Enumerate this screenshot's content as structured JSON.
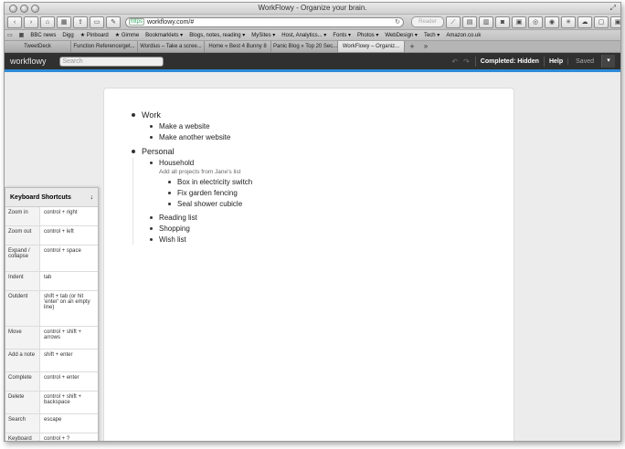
{
  "window": {
    "title": "WorkFlowy - Organize your brain."
  },
  "browser": {
    "toolbar_left": [
      "‹",
      "›",
      "⌂",
      "▦",
      "⇪",
      "▭",
      "✎"
    ],
    "toolbar_right": [
      "⟋",
      "▤",
      "▥",
      "◙",
      "▣",
      "◎",
      "◉",
      "✳",
      "☁",
      "▢",
      "▣",
      "⚙"
    ],
    "url_https": "https",
    "url": "workflowy.com/#",
    "reader": "Reader",
    "bookmarks": [
      "▭",
      "▦",
      "BBC news",
      "Digg",
      "★ Pinboard",
      "★ Gimme",
      "Bookmarklets ▾",
      "Blogs, notes, reading ▾",
      "MySites ▾",
      "Host, Analytics... ▾",
      "Fonts ▾",
      "Photos ▾",
      "WebDesign ▾",
      "Tech ▾",
      "Amazon.co.uk"
    ],
    "tabs": [
      {
        "label": "TweetDeck"
      },
      {
        "label": "Function Reference/get..."
      },
      {
        "label": "Wordius – Take a scree..."
      },
      {
        "label": "Home « Best 4 Bunny 8"
      },
      {
        "label": "Panic Blog » Top 20 Sec..."
      },
      {
        "label": "WorkFlowy – Organiz..."
      }
    ],
    "tab_plus": "+",
    "tab_overflow": "»"
  },
  "app": {
    "logo": "workflowy",
    "search_placeholder": "Search",
    "undo": "↶",
    "redo": "↷",
    "completed_btn": "Completed: Hidden",
    "help_btn": "Help",
    "saved": "Saved",
    "menu": "▾"
  },
  "outline": {
    "work": {
      "text": "Work",
      "children": [
        "Make a website",
        "Make another website"
      ]
    },
    "personal": {
      "text": "Personal",
      "household": {
        "text": "Household",
        "note": "Add all projects from Jane's list",
        "children": [
          "Box in electricity switch",
          "Fix garden fencing",
          "Seal shower cubicle"
        ]
      },
      "others": [
        "Reading list",
        "Shopping",
        "Wish list"
      ]
    }
  },
  "shortcuts": {
    "title": "Keyboard Shortcuts",
    "arrow": "↓",
    "rows": [
      {
        "action": "Zoom in",
        "keys": "control + right"
      },
      {
        "action": "Zoom out",
        "keys": "control + left"
      },
      {
        "action": "Expand / collapse",
        "keys": "control + space"
      },
      {
        "action": "Indent",
        "keys": "tab"
      },
      {
        "action": "Outdent",
        "keys": "shift + tab (or hit 'enter' on an empty line)"
      },
      {
        "action": "Move",
        "keys": "control + shift + arrows"
      },
      {
        "action": "Add a note",
        "keys": "shift + enter"
      },
      {
        "action": "Complete",
        "keys": "control + enter"
      },
      {
        "action": "Delete",
        "keys": "control + shift + backspace"
      },
      {
        "action": "Search",
        "keys": "escape"
      },
      {
        "action": "Keyboard shortcuts",
        "keys": "control + ?"
      }
    ]
  }
}
